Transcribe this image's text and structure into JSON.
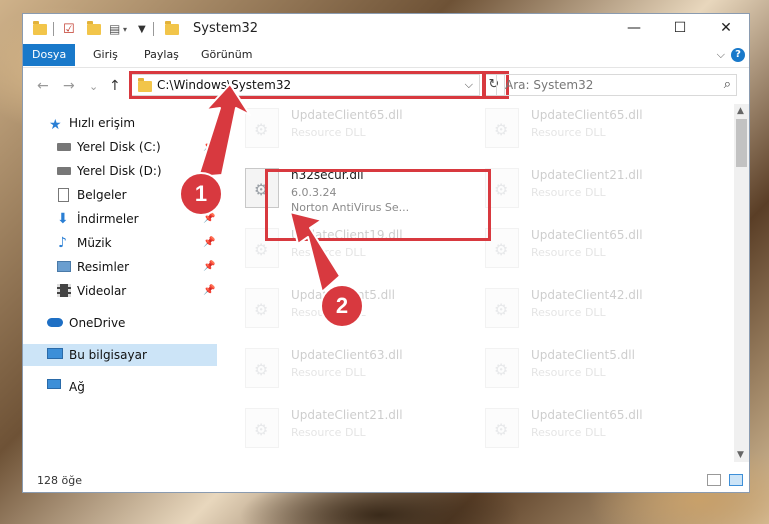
{
  "window": {
    "title": "System32",
    "controls": {
      "minimize": "—",
      "maximize": "☐",
      "close": "✕"
    }
  },
  "ribbon": {
    "tabs": [
      "Dosya",
      "Giriş",
      "Paylaş",
      "Görünüm"
    ],
    "help": "?",
    "toggle": "⌵"
  },
  "address_bar": {
    "path": "C:\\Windows\\System32",
    "dropdown": "⌵",
    "refresh": "↻"
  },
  "search": {
    "placeholder": "Ara: System32",
    "icon": "⌕"
  },
  "nav": {
    "back": "←",
    "forward": "→",
    "recent": "⌄",
    "up": "↑"
  },
  "sidebar": {
    "items": [
      {
        "label": "Hızlı erişim",
        "icon": "star-icon"
      },
      {
        "label": "Yerel Disk (C:)",
        "icon": "drive-icon"
      },
      {
        "label": "Yerel Disk (D:)",
        "icon": "drive-icon"
      },
      {
        "label": "Belgeler",
        "icon": "documents-icon"
      },
      {
        "label": "İndirmeler",
        "icon": "download-icon"
      },
      {
        "label": "Müzik",
        "icon": "music-icon"
      },
      {
        "label": "Resimler",
        "icon": "pictures-icon"
      },
      {
        "label": "Videolar",
        "icon": "video-icon"
      },
      {
        "label": "OneDrive",
        "icon": "cloud-icon"
      },
      {
        "label": "Bu bilgisayar",
        "icon": "computer-icon"
      },
      {
        "label": "Ağ",
        "icon": "network-icon"
      }
    ],
    "pin": "📌"
  },
  "files": {
    "highlighted": {
      "name": "n32secur.dll",
      "version": "6.0.3.24",
      "description": "Norton AntiVirus Se..."
    },
    "faded": [
      {
        "name": "UpdateClient65.dll",
        "type": "Resource DLL"
      },
      {
        "name": "UpdateClient65.dll",
        "type": "Resource DLL"
      },
      {
        "name": "UpdateClient21.dll",
        "type": "Resource DLL"
      },
      {
        "name": "UpdateClient19.dll",
        "type": "Resource DLL"
      },
      {
        "name": "UpdateClient65.dll",
        "type": "Resource DLL"
      },
      {
        "name": "UpdateClient5.dll",
        "type": "Resource DLL"
      },
      {
        "name": "UpdateClient42.dll",
        "type": "Resource DLL"
      },
      {
        "name": "UpdateClient63.dll",
        "type": "Resource DLL"
      },
      {
        "name": "UpdateClient5.dll",
        "type": "Resource DLL"
      },
      {
        "name": "UpdateClient21.dll",
        "type": "Resource DLL"
      },
      {
        "name": "UpdateClient65.dll",
        "type": "Resource DLL"
      }
    ]
  },
  "status": {
    "count": "128 öğe"
  },
  "annotations": {
    "step1": "1",
    "step2": "2",
    "color": "#d8393f"
  }
}
